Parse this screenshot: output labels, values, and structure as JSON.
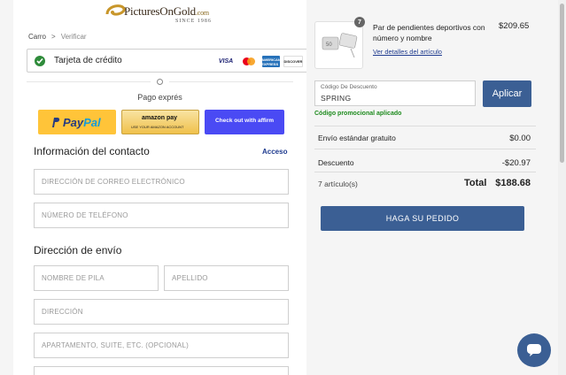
{
  "brand": {
    "logo_text": "PicturesOnGold",
    "logo_suffix": ".com",
    "since": "SINCE 1986"
  },
  "breadcrumb": {
    "cart": "Carro",
    "separator": ">",
    "checkout": "Verificar"
  },
  "payment": {
    "selected_method": "Tarjeta de crédito",
    "cards": [
      "VISA",
      "Mastercard",
      "AMEX",
      "DISCOVER"
    ],
    "visa_label": "VISA",
    "amex_label": "AMERICAN EXPRESS",
    "discover_label": "DISCOVER"
  },
  "express": {
    "label": "Pago exprés",
    "paypal_label_1": "Pay",
    "paypal_label_2": "Pal",
    "amazon_label": "amazon pay",
    "amazon_sub": "USE YOUR AMAZON ACCOUNT",
    "affirm_label": "Check out with affirm"
  },
  "contact": {
    "title": "Información del contacto",
    "login_link": "Acceso",
    "email_placeholder": "DIRECCIÓN DE CORREO ELECTRÓNICO",
    "phone_placeholder": "NÚMERO DE TELÉFONO"
  },
  "shipping": {
    "title": "Dirección de envío",
    "first_name_placeholder": "NOMBRE DE PILA",
    "last_name_placeholder": "APELLIDO",
    "address_placeholder": "DIRECCIÓN",
    "apt_placeholder": "APARTAMENTO, SUITE, ETC. (OPCIONAL)"
  },
  "cart": {
    "item": {
      "quantity": "7",
      "name": "Par de pendientes deportivos con número y nombre",
      "price": "$209.65",
      "details_link": "Ver detalles del artículo"
    },
    "coupon": {
      "label": "Código De Descuento",
      "value": "SPRING",
      "apply_label": "Aplicar",
      "success_message": "Código promocional aplicado"
    },
    "summary": {
      "shipping_label": "Envío estándar gratuito",
      "shipping_value": "$0.00",
      "discount_label": "Descuento",
      "discount_value": "-$20.97",
      "item_count": "7 artículo(s)",
      "total_label": "Total",
      "total_value": "$188.68"
    },
    "place_order_label": "HAGA SU PEDIDO"
  },
  "colors": {
    "primary_button": "#3b5f94",
    "success_green": "#1e8b1e",
    "link_blue": "#1f3b8f",
    "paypal_yellow": "#ffc439",
    "affirm_purple": "#4a4af4"
  },
  "icons": {
    "check": "check-circle-icon",
    "chat": "chat-bubble-icon",
    "breadcrumb_separator": "chevron-right-icon"
  }
}
